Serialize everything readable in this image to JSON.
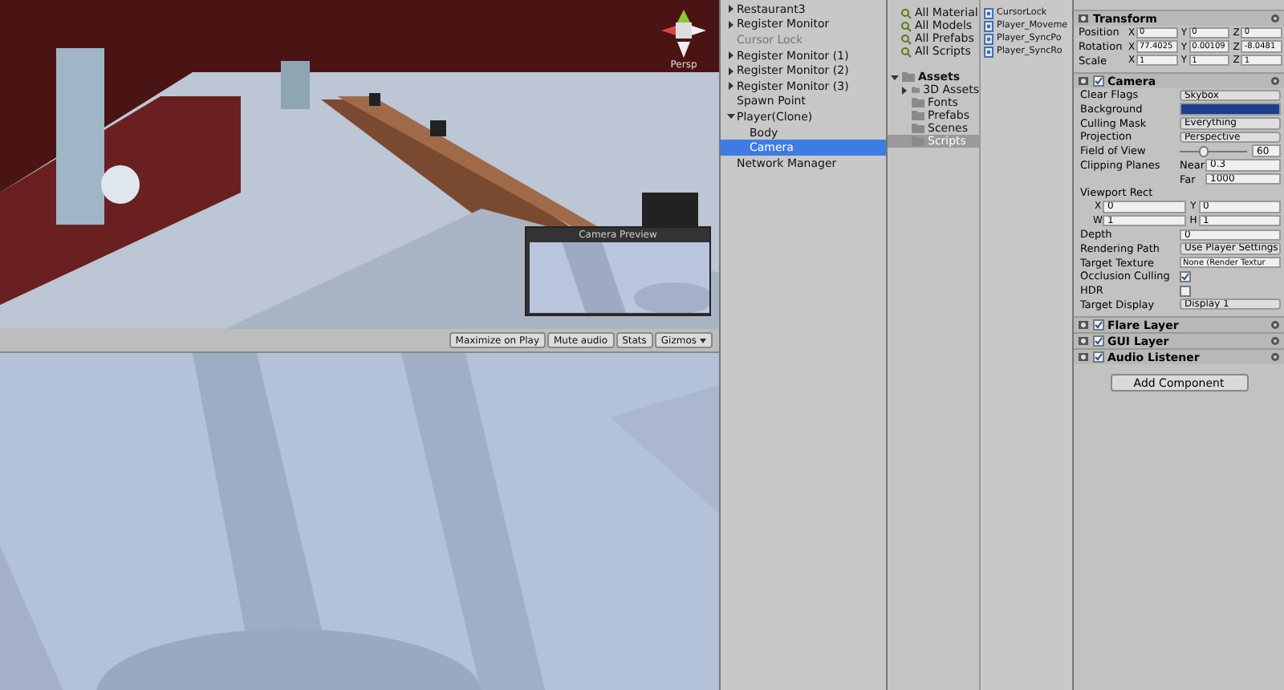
{
  "scene_view": {
    "gizmo_label": "Persp",
    "camera_preview": {
      "title": "Camera Preview"
    }
  },
  "game_toolbar": {
    "buttons": [
      {
        "label": "Maximize on Play",
        "selected": false
      },
      {
        "label": "Mute audio",
        "selected": false
      },
      {
        "label": "Stats",
        "selected": false
      },
      {
        "label": "Gizmos",
        "selected": false,
        "dropdown": true
      }
    ]
  },
  "hierarchy": {
    "items": [
      {
        "label": "Restaurant3",
        "expanded": false,
        "active": true,
        "selected": false
      },
      {
        "label": "Register Monitor",
        "expanded": false,
        "active": true,
        "selected": false
      },
      {
        "label": "Cursor Lock",
        "active": false,
        "selected": false
      },
      {
        "label": "Register Monitor (1)",
        "expanded": false,
        "active": true,
        "selected": false
      },
      {
        "label": "Register Monitor (2)",
        "expanded": false,
        "active": true,
        "selected": false
      },
      {
        "label": "Register Monitor (3)",
        "expanded": false,
        "active": true,
        "selected": false
      },
      {
        "label": "Spawn Point",
        "active": true,
        "selected": false
      },
      {
        "label": "Player(Clone)",
        "expanded": true,
        "active": true,
        "selected": false,
        "children": [
          {
            "label": "Body",
            "active": true,
            "selected": false
          },
          {
            "label": "Camera",
            "active": true,
            "selected": true
          }
        ]
      },
      {
        "label": "Network Manager",
        "active": true,
        "selected": false
      }
    ]
  },
  "project": {
    "favorites": [
      "All Material",
      "All Models",
      "All Prefabs",
      "All Scripts"
    ],
    "assets": {
      "label": "Assets",
      "expanded": true,
      "children": [
        {
          "label": "3D Assets",
          "expanded": false,
          "selected": false
        },
        {
          "label": "Fonts",
          "selected": false
        },
        {
          "label": "Prefabs",
          "selected": false
        },
        {
          "label": "Scenes",
          "selected": false
        },
        {
          "label": "Scripts",
          "selected": true
        }
      ]
    },
    "files": [
      "CursorLock",
      "Player_Moveme",
      "Player_SyncPo",
      "Player_SyncRo"
    ]
  },
  "inspector": {
    "transform": {
      "title": "Transform",
      "rows": [
        {
          "label": "Position",
          "values": [
            {
              "axis": "X",
              "value": "0"
            },
            {
              "axis": "Y",
              "value": "0"
            },
            {
              "axis": "Z",
              "value": "0"
            }
          ]
        },
        {
          "label": "Rotation",
          "values": [
            {
              "axis": "X",
              "value": "77.4025"
            },
            {
              "axis": "Y",
              "value": "0.00109"
            },
            {
              "axis": "Z",
              "value": "-8.0481"
            }
          ]
        },
        {
          "label": "Scale",
          "values": [
            {
              "axis": "X",
              "value": "1"
            },
            {
              "axis": "Y",
              "value": "1"
            },
            {
              "axis": "Z",
              "value": "1"
            }
          ]
        }
      ]
    },
    "camera": {
      "title": "Camera",
      "enabled": true,
      "fields": [
        {
          "kind": "dropdown",
          "label": "Clear Flags",
          "value": "Skybox"
        },
        {
          "kind": "color",
          "label": "Background"
        },
        {
          "kind": "dropdown",
          "label": "Culling Mask",
          "value": "Everything"
        },
        {
          "kind": "dropdown",
          "label": "Projection",
          "value": "Perspective"
        },
        {
          "kind": "slider",
          "label": "Field of View",
          "level": 0.35,
          "value": "60"
        },
        {
          "kind": "pair",
          "label": "Clipping Planes",
          "a_label": "Near",
          "a": "0.3"
        },
        {
          "kind": "pair",
          "a_label": "Far",
          "a": "1000"
        },
        {
          "kind": "heading",
          "label": "Viewport Rect"
        },
        {
          "kind": "rect",
          "a_label": "X",
          "a": "0",
          "b_label": "Y",
          "b": "0"
        },
        {
          "kind": "rect",
          "a_label": "W",
          "a": "1",
          "b_label": "H",
          "b": "1"
        },
        {
          "kind": "text",
          "label": "Depth",
          "value": "0"
        },
        {
          "kind": "dropdown",
          "label": "Rendering Path",
          "value": "Use Player Settings"
        },
        {
          "kind": "object",
          "label": "Target Texture",
          "value": "None (Render Textur"
        },
        {
          "kind": "check",
          "label": "Occlusion Culling",
          "checked": true
        },
        {
          "kind": "check",
          "label": "HDR",
          "checked": false
        },
        {
          "kind": "dropdown",
          "label": "Target Display",
          "value": "Display 1"
        }
      ]
    },
    "components": [
      {
        "title": "Flare Layer",
        "enabled": true
      },
      {
        "title": "GUI Layer",
        "enabled": true
      },
      {
        "title": "Audio Listener",
        "enabled": true
      }
    ],
    "add_button": "Add Component"
  }
}
